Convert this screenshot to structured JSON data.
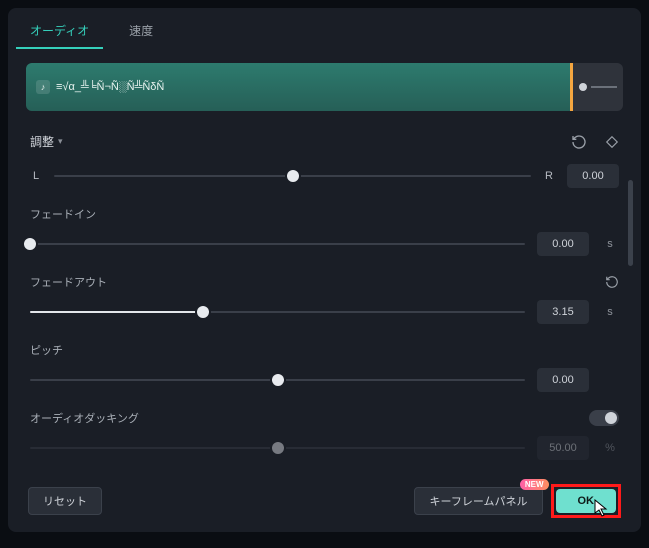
{
  "tabs": {
    "audio": "オーディオ",
    "speed": "速度"
  },
  "clip": {
    "title": "≡√α_╩╘Ñ¬Ñ░Ñ╩ÑδÑ"
  },
  "section": {
    "title": "調整"
  },
  "balance": {
    "left_label": "L",
    "right_label": "R",
    "value": "0.00",
    "pos_pct": 50
  },
  "fade_in": {
    "label": "フェードイン",
    "value": "0.00",
    "unit": "s",
    "pos_pct": 0
  },
  "fade_out": {
    "label": "フェードアウト",
    "value": "3.15",
    "unit": "s",
    "pos_pct": 35
  },
  "pitch": {
    "label": "ピッチ",
    "value": "0.00",
    "pos_pct": 50
  },
  "ducking": {
    "label": "オーディオダッキング",
    "value": "50.00",
    "unit": "%",
    "pos_pct": 50
  },
  "footer": {
    "reset": "リセット",
    "keyframe": "キーフレームパネル",
    "new_badge": "NEW",
    "ok": "OK"
  },
  "colors": {
    "accent": "#35d0bb",
    "highlight": "#ff1a1a"
  }
}
